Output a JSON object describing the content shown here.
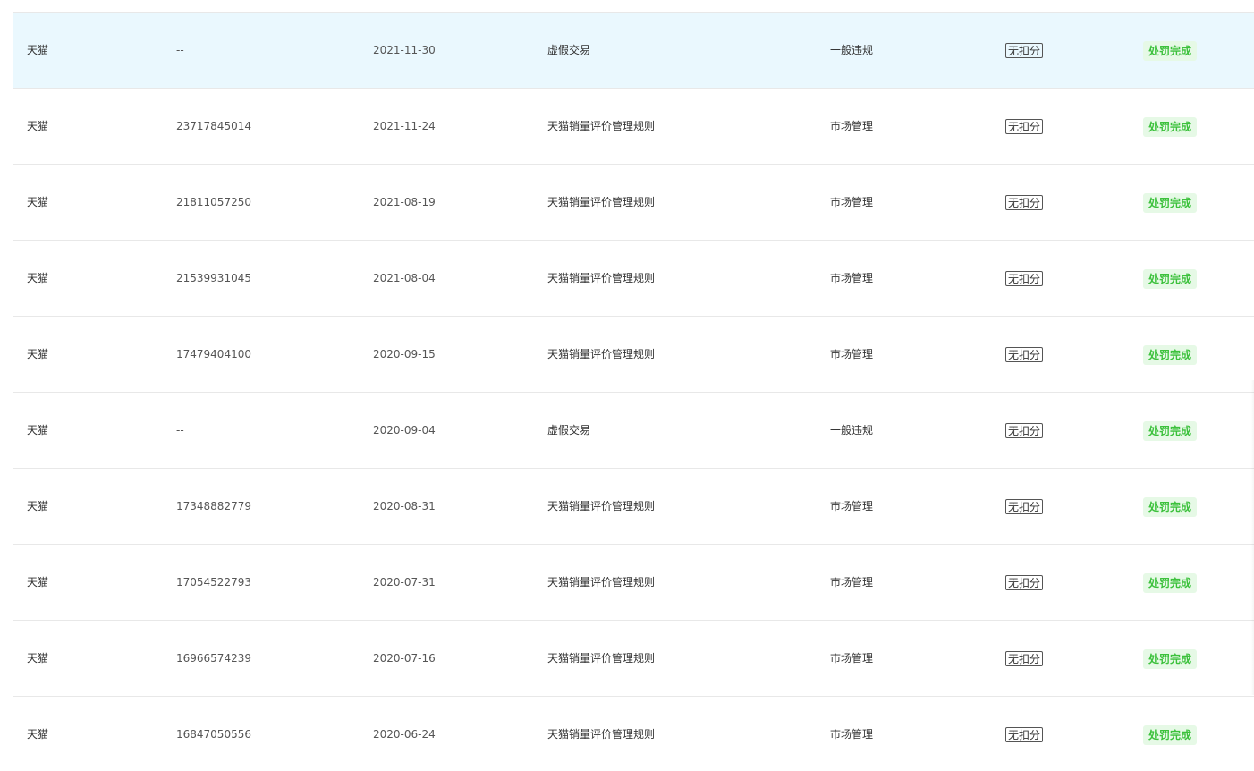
{
  "table": {
    "rows": [
      {
        "platform": "天猫",
        "id": "--",
        "date": "2021-11-30",
        "rule": "虚假交易",
        "type": "一般违规",
        "score": "无扣分",
        "status": "处罚完成"
      },
      {
        "platform": "天猫",
        "id": "23717845014",
        "date": "2021-11-24",
        "rule": "天猫销量评价管理规则",
        "type": "市场管理",
        "score": "无扣分",
        "status": "处罚完成"
      },
      {
        "platform": "天猫",
        "id": "21811057250",
        "date": "2021-08-19",
        "rule": "天猫销量评价管理规则",
        "type": "市场管理",
        "score": "无扣分",
        "status": "处罚完成"
      },
      {
        "platform": "天猫",
        "id": "21539931045",
        "date": "2021-08-04",
        "rule": "天猫销量评价管理规则",
        "type": "市场管理",
        "score": "无扣分",
        "status": "处罚完成"
      },
      {
        "platform": "天猫",
        "id": "17479404100",
        "date": "2020-09-15",
        "rule": "天猫销量评价管理规则",
        "type": "市场管理",
        "score": "无扣分",
        "status": "处罚完成"
      },
      {
        "platform": "天猫",
        "id": "--",
        "date": "2020-09-04",
        "rule": "虚假交易",
        "type": "一般违规",
        "score": "无扣分",
        "status": "处罚完成"
      },
      {
        "platform": "天猫",
        "id": "17348882779",
        "date": "2020-08-31",
        "rule": "天猫销量评价管理规则",
        "type": "市场管理",
        "score": "无扣分",
        "status": "处罚完成"
      },
      {
        "platform": "天猫",
        "id": "17054522793",
        "date": "2020-07-31",
        "rule": "天猫销量评价管理规则",
        "type": "市场管理",
        "score": "无扣分",
        "status": "处罚完成"
      },
      {
        "platform": "天猫",
        "id": "16966574239",
        "date": "2020-07-16",
        "rule": "天猫销量评价管理规则",
        "type": "市场管理",
        "score": "无扣分",
        "status": "处罚完成"
      },
      {
        "platform": "天猫",
        "id": "16847050556",
        "date": "2020-06-24",
        "rule": "天猫销量评价管理规则",
        "type": "市场管理",
        "score": "无扣分",
        "status": "处罚完成"
      }
    ],
    "colors": {
      "highlight_row_bg": "#eaf8fe",
      "status_text": "#3cc13c",
      "status_bg": "#e6f9e6",
      "divider": "#e8e8e8"
    }
  }
}
